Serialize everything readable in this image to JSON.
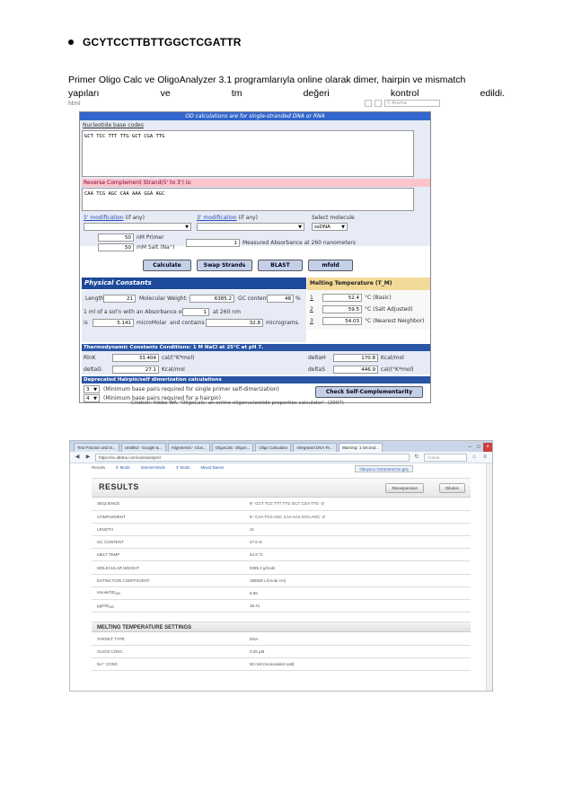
{
  "heading": {
    "sequence": "GCYTCCTTBTTGGCTCGATTR"
  },
  "paragraph": {
    "line1": "Primer Oligo Calc ve OligoAnalyzer 3.1 programlarıyla online olarak dimer, hairpin ve mismatch",
    "line2_words": [
      "yapıları",
      "ve",
      "tm",
      "değeri",
      "kontrol",
      "edildi."
    ]
  },
  "oligocalc": {
    "browser": {
      "url_fragment": "html",
      "search_placeholder": "Arama"
    },
    "title": "OD calculations are for single-stranded DNA or RNA",
    "nucleotide_link": "Nucleotide base codes",
    "sequence_text": "GCT TCC TTT TTG GCT CGA TTG",
    "revcomp_label": "Reverse Complement Strand(5' to 3') is:",
    "revcomp_text": "CAA TCG AGC CAA AAA GGA AGC",
    "mod5_link": "5' modification",
    "mod5_suffix": "(if any)",
    "mod3_link": "3' modification",
    "mod3_suffix": "(if any)",
    "select_molecule_label": "Select molecule",
    "molecule_value": "ssDNA",
    "primer_conc_value": "50",
    "primer_conc_label": "nM Primer",
    "salt_value": "50",
    "salt_label": "mM Salt (Na⁺)",
    "absorbance_value": "1",
    "absorbance_label": "Measured Absorbance at 260 nanometers",
    "buttons": [
      "Calculate",
      "Swap Strands",
      "BLAST",
      "mfold"
    ],
    "physical_header": "Physical Constants",
    "melting_header": "Melting Temperature (T_M) Calculations",
    "length_label": "Length:",
    "length_value": "21",
    "mw_label": "Molecular Weight:",
    "mw_value": "6385.2",
    "gc_label": "GC content:",
    "gc_value": "48",
    "gc_unit": "%",
    "sol_label": "1 ml of a sol'n with an Absorbance of",
    "sol_value": "1",
    "sol_unit": "at 260 nm",
    "is_label": "is",
    "micromolar_value": "5.141",
    "micromolar_label": "microMolar",
    "contains_label": "and contains",
    "micrograms_value": "32.8",
    "micrograms_label": "micrograms.",
    "tm_rows": [
      {
        "idx": "1",
        "value": "52.4",
        "label": "°C (Basic)"
      },
      {
        "idx": "2",
        "value": "59.5",
        "label": "°C (Salt Adjusted)"
      },
      {
        "idx": "3",
        "value": "54.03",
        "label": "°C (Nearest Neighbor)"
      }
    ],
    "thermo_header": "Thermodynamic Constants Conditions: 1 M NaCl at 25°C at pH 7.",
    "rinfs_label": "RlnK",
    "rinfs_value": "33.404",
    "rinfs_unit": "cal/(°K*mol)",
    "deltaG_label": "deltaG",
    "deltaG_value": "27.1",
    "deltaG_unit": "Kcal/mol",
    "deltaH_label": "deltaH",
    "deltaH_value": "170.8",
    "deltaH_unit": "Kcal/mol",
    "deltaS_label": "deltaS",
    "deltaS_value": "446.9",
    "deltaS_unit": "cal/(°K*mol)",
    "hairpin_header": "Deprecated Hairpin/self dimerization calculations",
    "min_dimer_value": "3",
    "min_dimer_label": "(Minimum base pairs required for single primer self-dimerization)",
    "min_hairpin_value": "4",
    "min_hairpin_label": "(Minimum base pairs required for a hairpin)",
    "check_button": "Check Self-Complementarity",
    "citation": "Citation: Kibbe WA. 'OligoCalc: an online oligonucleotide properties calculator'. (2007)"
  },
  "oligoanalyzer": {
    "tabs": [
      "Text Fraction and D...",
      "Untitled - Google &...",
      "Alignments - Clus...",
      "OligoCalc: Oligon...",
      "Oligo Calculator",
      "Integrated DNA Te...",
      "Warning: 1 second..."
    ],
    "url": "https://eu.idtdna.com/calc/analyzer",
    "search_placeholder": "Arama",
    "links": [
      "Results",
      "5' Mods",
      "Internal Mods",
      "3' Mods",
      "Mixed Bases"
    ],
    "user_box": "Okuyucu Görünümü'ne geç",
    "results_title": "RESULTS",
    "btn_resuspension": "Resuspension",
    "btn_dilution": "Dilution",
    "rows": [
      {
        "key": "SEQUENCE",
        "value": "5'- GCT TCC TTT TTG GCT CGA TTG -3'"
      },
      {
        "key": "COMPLEMENT",
        "value": "5'- CAA TCG AGC CAA AAA GGA AGC -3'"
      },
      {
        "key": "LENGTH",
        "value": "21"
      },
      {
        "key": "GC CONTENT",
        "value": "47.6 %"
      },
      {
        "key": "MELT TEMP",
        "value": "54.9 ºC"
      },
      {
        "key": "MOLECULAR WEIGHT",
        "value": "6385.3 g/mole"
      },
      {
        "key": "EXTINCTION COEFFICIENT",
        "value": "185000 L/(mole·cm)"
      },
      {
        "key": "nmole/OD",
        "sub": "260",
        "value": "5.55"
      },
      {
        "key": "µg/OD",
        "sub": "260",
        "value": "35.41"
      }
    ],
    "melt_settings_title": "MELTING TEMPERATURE SETTINGS",
    "melt_rows": [
      {
        "key": "TARGET TYPE",
        "value": "DNA"
      },
      {
        "key": "OLIGO CONC",
        "value": "0.25 µM"
      },
      {
        "key": "NA⁺ CONC",
        "value": "50 mM (monovalent salt)"
      }
    ]
  }
}
